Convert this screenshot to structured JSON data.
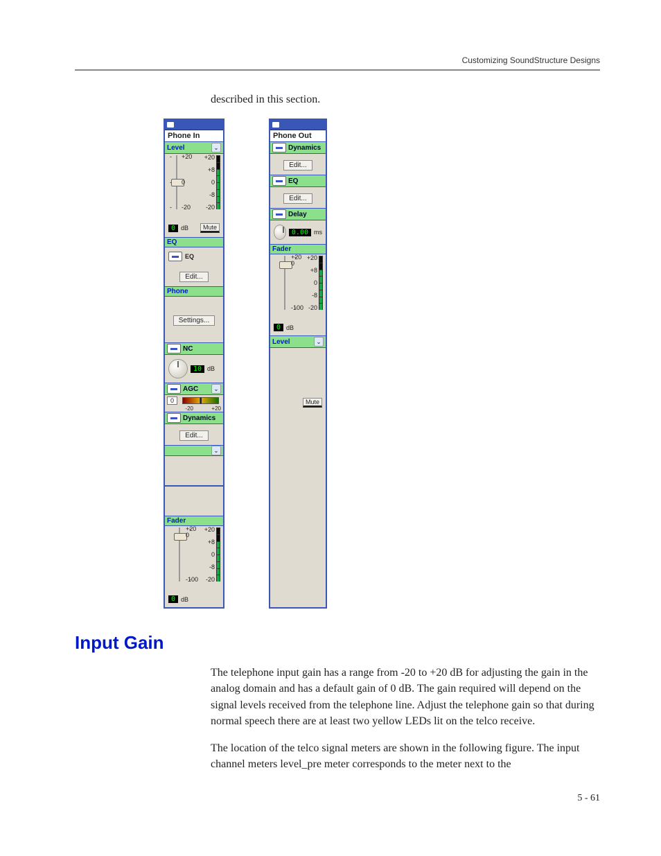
{
  "header": {
    "running": "Customizing SoundStructure Designs"
  },
  "paragraphs": {
    "intro": "described in this section.",
    "body1": "The telephone input gain has a range from -20 to +20 dB for adjusting the gain in the analog domain and has a default gain of 0 dB. The gain required will depend on the signal levels received from the telephone line. Adjust the telephone gain so that during normal speech there are at least two yellow LEDs lit on the telco receive.",
    "body2": "The location of the telco signal meters are shown in the following figure. The input channel meters level_pre meter corresponds to the meter next to the"
  },
  "heading": "Input Gain",
  "pagenum": "5 - 61",
  "phone_in": {
    "title": "Phone In",
    "level": {
      "label": "Level",
      "ticks": [
        "+20",
        "0",
        "-20"
      ],
      "meter_labels": [
        "+20",
        "+8",
        "0",
        "-8",
        "-20"
      ],
      "value": "0",
      "unit": "dB",
      "mute": "Mute"
    },
    "eq_section": {
      "label": "EQ",
      "inner_label": "EQ",
      "btn": "Edit..."
    },
    "phone_section": {
      "label": "Phone",
      "btn": "Settings..."
    },
    "nc": {
      "label": "NC",
      "value": "10",
      "unit": "dB"
    },
    "agc": {
      "label": "AGC",
      "value": "0",
      "lo": "-20",
      "hi": "+20"
    },
    "dyn": {
      "label": "Dynamics",
      "btn": "Edit..."
    },
    "fader": {
      "label": "Fader",
      "ticks": [
        "+20",
        "0",
        "-100"
      ],
      "meter_labels": [
        "+20",
        "+8",
        "0",
        "-8",
        "-20"
      ],
      "value": "0",
      "unit": "dB"
    }
  },
  "phone_out": {
    "title": "Phone Out",
    "dyn": {
      "label": "Dynamics",
      "btn": "Edit..."
    },
    "eq": {
      "label": "EQ",
      "btn": "Edit..."
    },
    "delay": {
      "label": "Delay",
      "value": "0.00",
      "unit": "ms"
    },
    "fader": {
      "label": "Fader",
      "ticks": [
        "+20",
        "0",
        "-100"
      ],
      "meter_labels": [
        "+20",
        "+8",
        "0",
        "-8",
        "-20"
      ],
      "value": "0",
      "unit": "dB"
    },
    "level": {
      "label": "Level",
      "mute": "Mute"
    }
  }
}
